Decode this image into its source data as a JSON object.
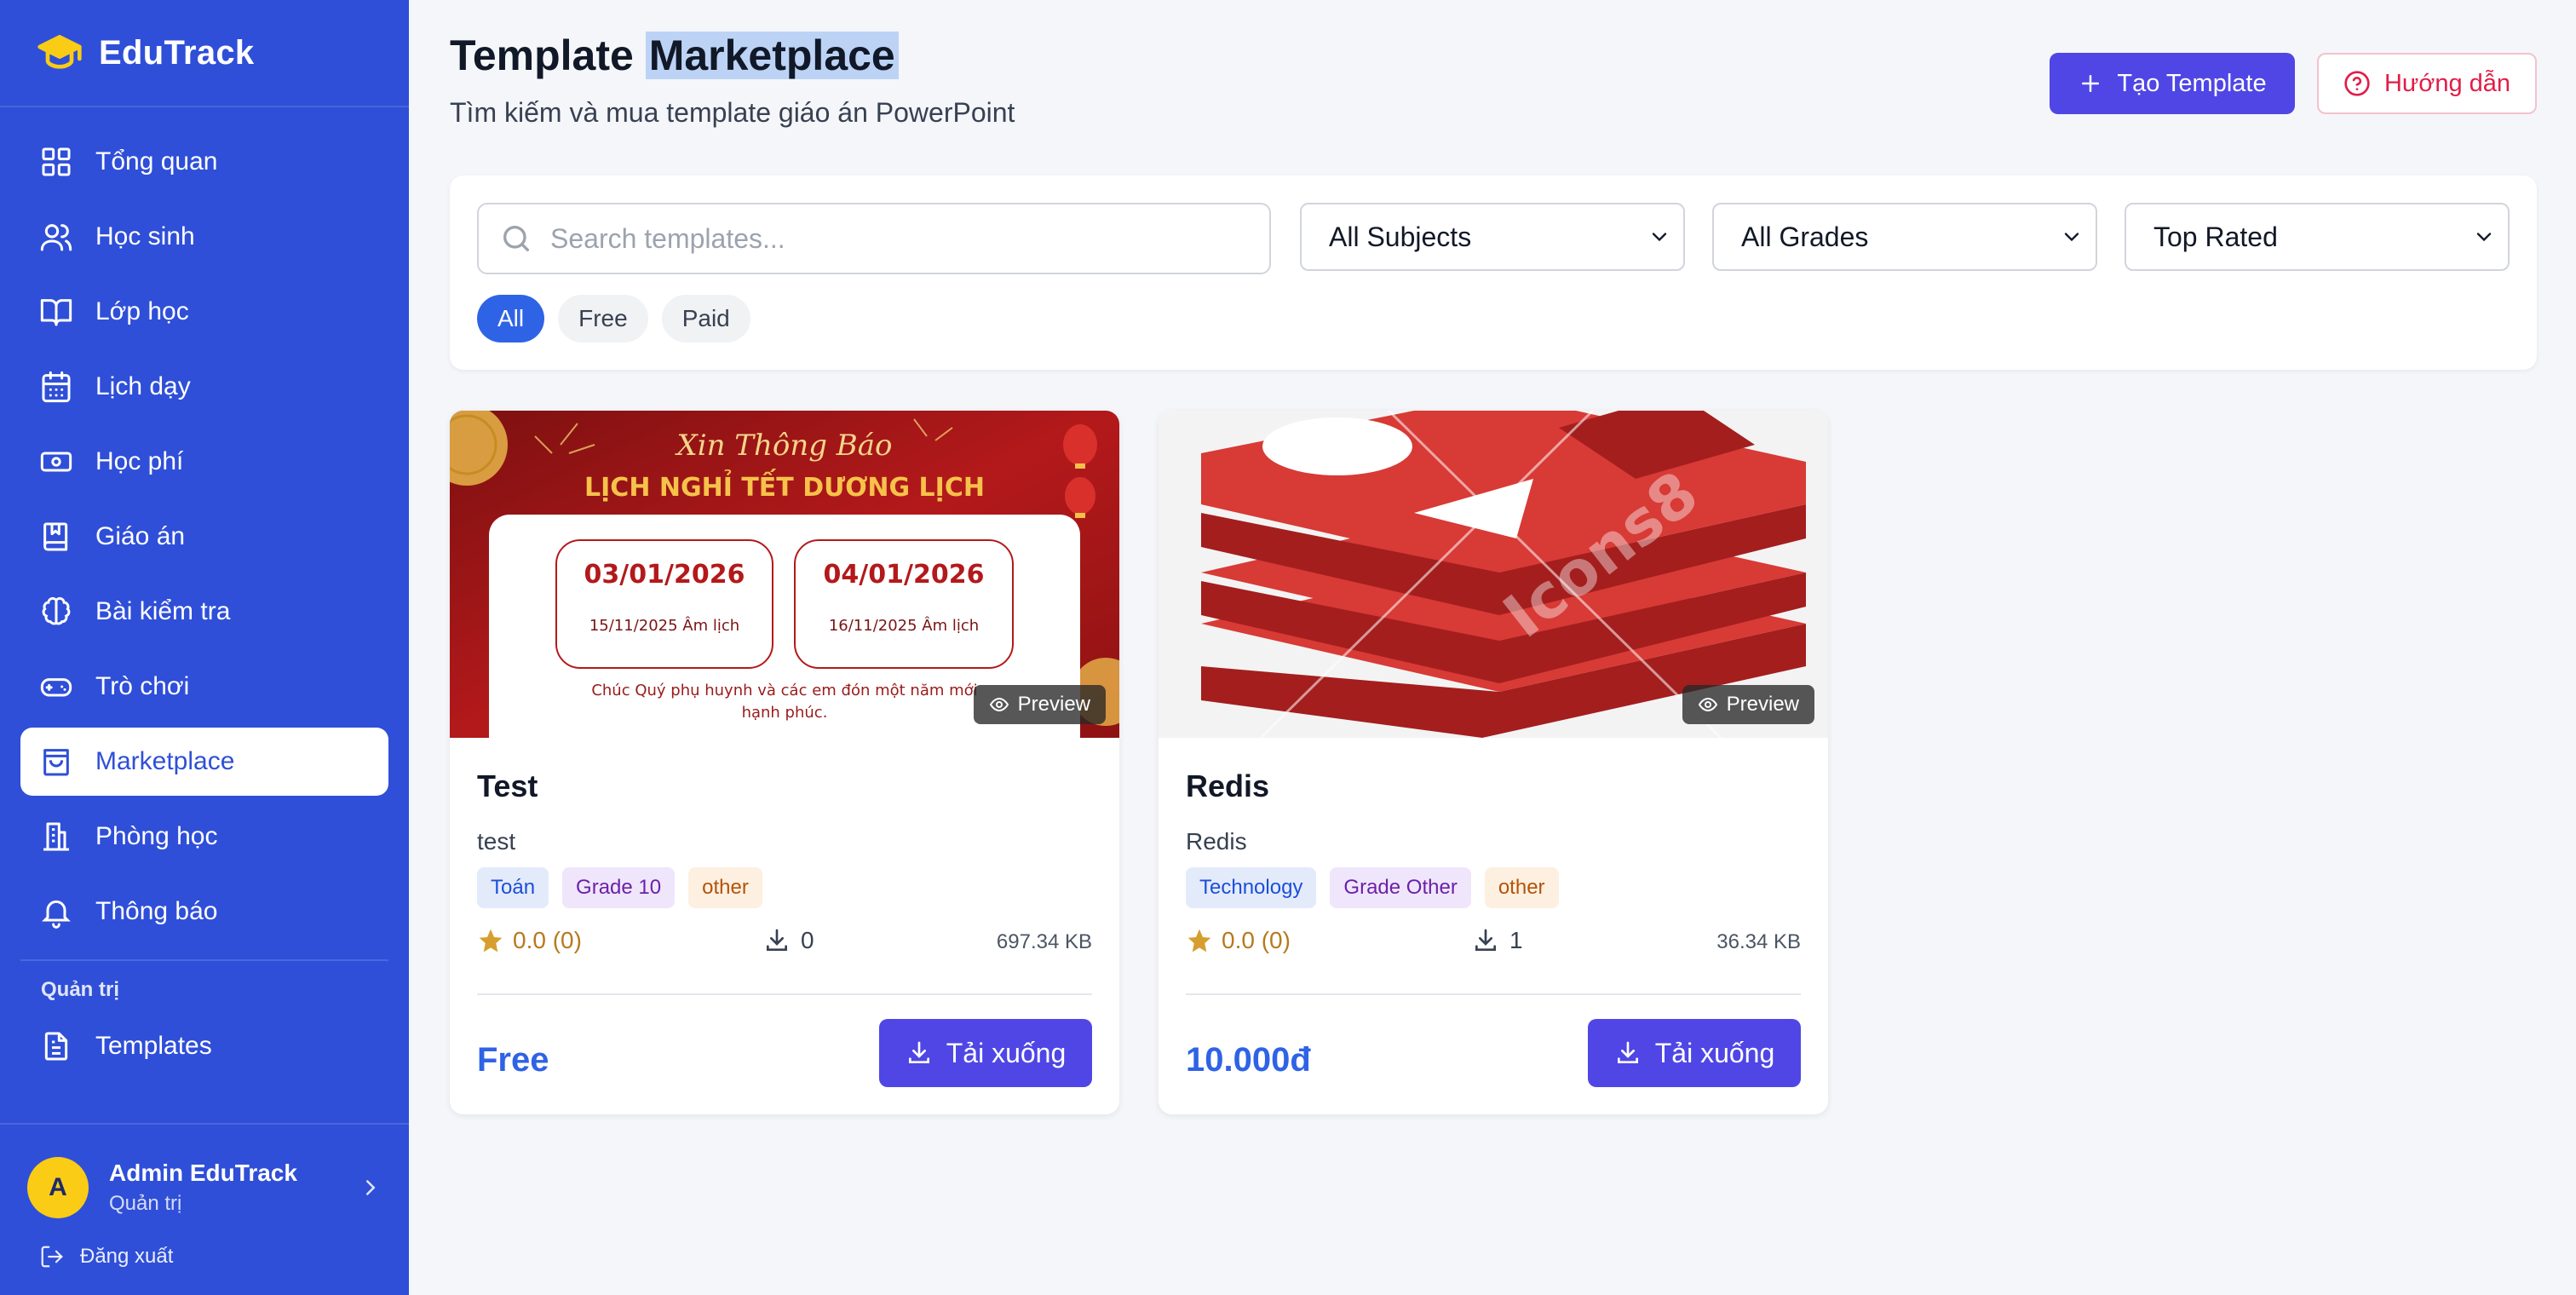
{
  "brand": {
    "name": "EduTrack",
    "icon": "graduation-cap-icon"
  },
  "sidebar": {
    "items": [
      {
        "label": "Tổng quan",
        "icon": "dashboard-icon",
        "active": false
      },
      {
        "label": "Học sinh",
        "icon": "users-icon",
        "active": false
      },
      {
        "label": "Lớp học",
        "icon": "book-open-icon",
        "active": false
      },
      {
        "label": "Lịch dạy",
        "icon": "calendar-icon",
        "active": false
      },
      {
        "label": "Học phí",
        "icon": "banknote-icon",
        "active": false
      },
      {
        "label": "Giáo án",
        "icon": "notebook-icon",
        "active": false
      },
      {
        "label": "Bài kiểm tra",
        "icon": "brain-icon",
        "active": false
      },
      {
        "label": "Trò chơi",
        "icon": "gamepad-icon",
        "active": false
      },
      {
        "label": "Marketplace",
        "icon": "shopping-bag-icon",
        "active": true
      },
      {
        "label": "Phòng học",
        "icon": "building-icon",
        "active": false
      },
      {
        "label": "Thông báo",
        "icon": "bell-icon",
        "active": false
      }
    ],
    "admin_section": {
      "label": "Quản trị",
      "items": [
        {
          "label": "Templates",
          "icon": "file-text-icon"
        }
      ]
    },
    "user": {
      "initial": "A",
      "name": "Admin EduTrack",
      "role": "Quản trị"
    },
    "logout_label": "Đăng xuất"
  },
  "header": {
    "title_part1": "Template",
    "title_part2": "Marketplace",
    "subtitle": "Tìm kiếm và mua template giáo án PowerPoint",
    "create_button": "Tạo Template",
    "guide_button": "Hướng dẫn"
  },
  "filters": {
    "search_placeholder": "Search templates...",
    "subject": "All Subjects",
    "grade": "All Grades",
    "sort": "Top Rated",
    "chips": [
      "All",
      "Free",
      "Paid"
    ],
    "active_chip": "All"
  },
  "cards": [
    {
      "title": "Test",
      "description": "test",
      "tags": [
        "Toán",
        "Grade 10",
        "other"
      ],
      "rating": "0.0 (0)",
      "downloads": "0",
      "size": "697.34 KB",
      "price": "Free",
      "download_label": "Tải xuống",
      "preview_label": "Preview",
      "thumb": {
        "heading_script": "Xin Thông Báo",
        "heading": "LỊCH NGHỈ TẾT DƯƠNG LỊCH",
        "date1": "03/01/2026",
        "date1_sub": "15/11/2025 Âm lịch",
        "date2": "04/01/2026",
        "date2_sub": "16/11/2025 Âm lịch",
        "message": "Chúc Quý phụ huynh và các em đón một năm mới",
        "message2": "hạnh phúc."
      }
    },
    {
      "title": "Redis",
      "description": "Redis",
      "tags": [
        "Technology",
        "Grade Other",
        "other"
      ],
      "rating": "0.0 (0)",
      "downloads": "1",
      "size": "36.34 KB",
      "price": "10.000đ",
      "download_label": "Tải xuống",
      "preview_label": "Preview",
      "thumb": {
        "watermark": "Icons8"
      }
    }
  ],
  "colors": {
    "sidebar": "#2f4fd8",
    "primary_button": "#4f46e5",
    "price": "#2f63e6",
    "guide": "#e11d48"
  }
}
